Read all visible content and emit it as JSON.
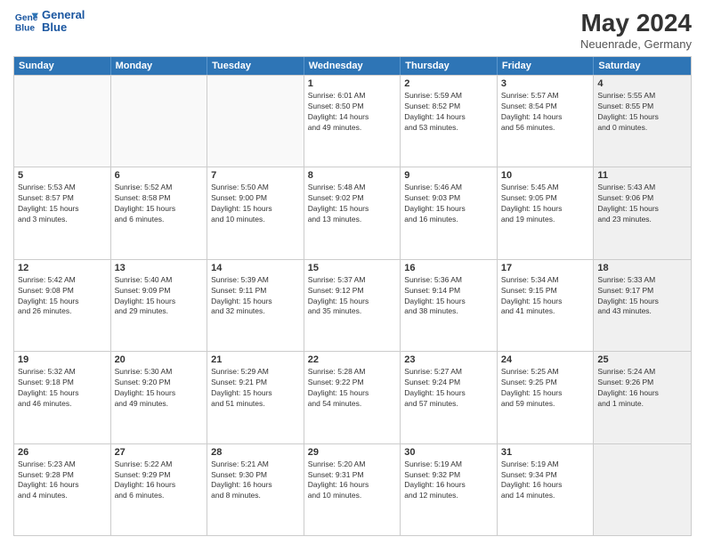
{
  "header": {
    "logo_line1": "General",
    "logo_line2": "Blue",
    "month": "May 2024",
    "location": "Neuenrade, Germany"
  },
  "weekdays": [
    "Sunday",
    "Monday",
    "Tuesday",
    "Wednesday",
    "Thursday",
    "Friday",
    "Saturday"
  ],
  "rows": [
    [
      {
        "day": "",
        "lines": [],
        "empty": true
      },
      {
        "day": "",
        "lines": [],
        "empty": true
      },
      {
        "day": "",
        "lines": [],
        "empty": true
      },
      {
        "day": "1",
        "lines": [
          "Sunrise: 6:01 AM",
          "Sunset: 8:50 PM",
          "Daylight: 14 hours",
          "and 49 minutes."
        ]
      },
      {
        "day": "2",
        "lines": [
          "Sunrise: 5:59 AM",
          "Sunset: 8:52 PM",
          "Daylight: 14 hours",
          "and 53 minutes."
        ]
      },
      {
        "day": "3",
        "lines": [
          "Sunrise: 5:57 AM",
          "Sunset: 8:54 PM",
          "Daylight: 14 hours",
          "and 56 minutes."
        ]
      },
      {
        "day": "4",
        "lines": [
          "Sunrise: 5:55 AM",
          "Sunset: 8:55 PM",
          "Daylight: 15 hours",
          "and 0 minutes."
        ],
        "shaded": true
      }
    ],
    [
      {
        "day": "5",
        "lines": [
          "Sunrise: 5:53 AM",
          "Sunset: 8:57 PM",
          "Daylight: 15 hours",
          "and 3 minutes."
        ]
      },
      {
        "day": "6",
        "lines": [
          "Sunrise: 5:52 AM",
          "Sunset: 8:58 PM",
          "Daylight: 15 hours",
          "and 6 minutes."
        ]
      },
      {
        "day": "7",
        "lines": [
          "Sunrise: 5:50 AM",
          "Sunset: 9:00 PM",
          "Daylight: 15 hours",
          "and 10 minutes."
        ]
      },
      {
        "day": "8",
        "lines": [
          "Sunrise: 5:48 AM",
          "Sunset: 9:02 PM",
          "Daylight: 15 hours",
          "and 13 minutes."
        ]
      },
      {
        "day": "9",
        "lines": [
          "Sunrise: 5:46 AM",
          "Sunset: 9:03 PM",
          "Daylight: 15 hours",
          "and 16 minutes."
        ]
      },
      {
        "day": "10",
        "lines": [
          "Sunrise: 5:45 AM",
          "Sunset: 9:05 PM",
          "Daylight: 15 hours",
          "and 19 minutes."
        ]
      },
      {
        "day": "11",
        "lines": [
          "Sunrise: 5:43 AM",
          "Sunset: 9:06 PM",
          "Daylight: 15 hours",
          "and 23 minutes."
        ],
        "shaded": true
      }
    ],
    [
      {
        "day": "12",
        "lines": [
          "Sunrise: 5:42 AM",
          "Sunset: 9:08 PM",
          "Daylight: 15 hours",
          "and 26 minutes."
        ]
      },
      {
        "day": "13",
        "lines": [
          "Sunrise: 5:40 AM",
          "Sunset: 9:09 PM",
          "Daylight: 15 hours",
          "and 29 minutes."
        ]
      },
      {
        "day": "14",
        "lines": [
          "Sunrise: 5:39 AM",
          "Sunset: 9:11 PM",
          "Daylight: 15 hours",
          "and 32 minutes."
        ]
      },
      {
        "day": "15",
        "lines": [
          "Sunrise: 5:37 AM",
          "Sunset: 9:12 PM",
          "Daylight: 15 hours",
          "and 35 minutes."
        ]
      },
      {
        "day": "16",
        "lines": [
          "Sunrise: 5:36 AM",
          "Sunset: 9:14 PM",
          "Daylight: 15 hours",
          "and 38 minutes."
        ]
      },
      {
        "day": "17",
        "lines": [
          "Sunrise: 5:34 AM",
          "Sunset: 9:15 PM",
          "Daylight: 15 hours",
          "and 41 minutes."
        ]
      },
      {
        "day": "18",
        "lines": [
          "Sunrise: 5:33 AM",
          "Sunset: 9:17 PM",
          "Daylight: 15 hours",
          "and 43 minutes."
        ],
        "shaded": true
      }
    ],
    [
      {
        "day": "19",
        "lines": [
          "Sunrise: 5:32 AM",
          "Sunset: 9:18 PM",
          "Daylight: 15 hours",
          "and 46 minutes."
        ]
      },
      {
        "day": "20",
        "lines": [
          "Sunrise: 5:30 AM",
          "Sunset: 9:20 PM",
          "Daylight: 15 hours",
          "and 49 minutes."
        ]
      },
      {
        "day": "21",
        "lines": [
          "Sunrise: 5:29 AM",
          "Sunset: 9:21 PM",
          "Daylight: 15 hours",
          "and 51 minutes."
        ]
      },
      {
        "day": "22",
        "lines": [
          "Sunrise: 5:28 AM",
          "Sunset: 9:22 PM",
          "Daylight: 15 hours",
          "and 54 minutes."
        ]
      },
      {
        "day": "23",
        "lines": [
          "Sunrise: 5:27 AM",
          "Sunset: 9:24 PM",
          "Daylight: 15 hours",
          "and 57 minutes."
        ]
      },
      {
        "day": "24",
        "lines": [
          "Sunrise: 5:25 AM",
          "Sunset: 9:25 PM",
          "Daylight: 15 hours",
          "and 59 minutes."
        ]
      },
      {
        "day": "25",
        "lines": [
          "Sunrise: 5:24 AM",
          "Sunset: 9:26 PM",
          "Daylight: 16 hours",
          "and 1 minute."
        ],
        "shaded": true
      }
    ],
    [
      {
        "day": "26",
        "lines": [
          "Sunrise: 5:23 AM",
          "Sunset: 9:28 PM",
          "Daylight: 16 hours",
          "and 4 minutes."
        ]
      },
      {
        "day": "27",
        "lines": [
          "Sunrise: 5:22 AM",
          "Sunset: 9:29 PM",
          "Daylight: 16 hours",
          "and 6 minutes."
        ]
      },
      {
        "day": "28",
        "lines": [
          "Sunrise: 5:21 AM",
          "Sunset: 9:30 PM",
          "Daylight: 16 hours",
          "and 8 minutes."
        ]
      },
      {
        "day": "29",
        "lines": [
          "Sunrise: 5:20 AM",
          "Sunset: 9:31 PM",
          "Daylight: 16 hours",
          "and 10 minutes."
        ]
      },
      {
        "day": "30",
        "lines": [
          "Sunrise: 5:19 AM",
          "Sunset: 9:32 PM",
          "Daylight: 16 hours",
          "and 12 minutes."
        ]
      },
      {
        "day": "31",
        "lines": [
          "Sunrise: 5:19 AM",
          "Sunset: 9:34 PM",
          "Daylight: 16 hours",
          "and 14 minutes."
        ]
      },
      {
        "day": "",
        "lines": [],
        "empty": true,
        "shaded": true
      }
    ]
  ]
}
